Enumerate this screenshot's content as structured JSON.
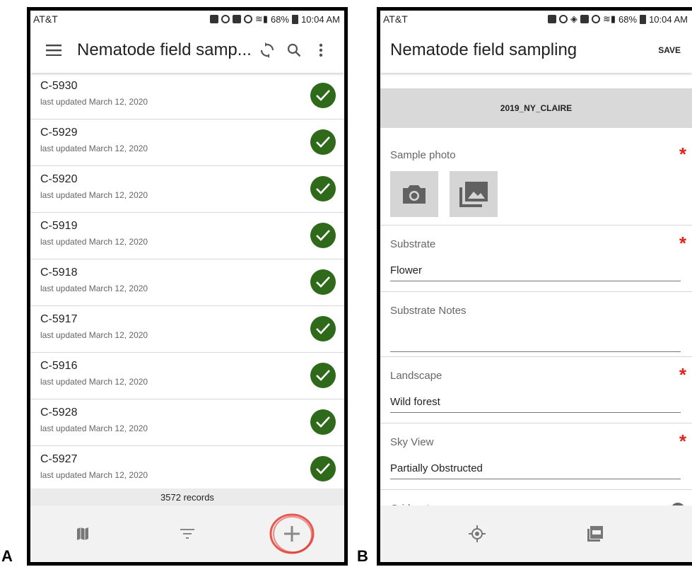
{
  "panels": {
    "a": "A",
    "b": "B"
  },
  "statusbar": {
    "carrier": "AT&T",
    "battery": "68%",
    "time": "10:04 AM"
  },
  "list_screen": {
    "title": "Nematode field samp...",
    "items": [
      {
        "id": "C-5930",
        "updated": "last updated March 12, 2020"
      },
      {
        "id": "C-5929",
        "updated": "last updated March 12, 2020"
      },
      {
        "id": "C-5920",
        "updated": "last updated March 12, 2020"
      },
      {
        "id": "C-5919",
        "updated": "last updated March 12, 2020"
      },
      {
        "id": "C-5918",
        "updated": "last updated March 12, 2020"
      },
      {
        "id": "C-5917",
        "updated": "last updated March 12, 2020"
      },
      {
        "id": "C-5916",
        "updated": "last updated March 12, 2020"
      },
      {
        "id": "C-5928",
        "updated": "last updated March 12, 2020"
      },
      {
        "id": "C-5927",
        "updated": "last updated March 12, 2020"
      }
    ],
    "records_count": "3572 records",
    "nav_icons": [
      "map-icon",
      "filter-icon",
      "add-icon"
    ],
    "check_color": "#2e6a1a",
    "highlight_color": "#e0251b"
  },
  "form_screen": {
    "title": "Nematode field sampling",
    "save_label": "SAVE",
    "project": "2019_NY_CLAIRE",
    "fields": {
      "photo": {
        "label": "Sample photo",
        "required": "*"
      },
      "substrate": {
        "label": "Substrate",
        "value": "Flower",
        "required": "*"
      },
      "substrate_notes": {
        "label": "Substrate Notes",
        "value": ""
      },
      "landscape": {
        "label": "Landscape",
        "value": "Wild forest",
        "required": "*"
      },
      "sky_view": {
        "label": "Sky View",
        "value": "Partially Obstructed",
        "required": "*"
      },
      "gridsect": {
        "label": "Gridsect"
      }
    },
    "accent_color": "#18a1e8",
    "required_color": "#e0251b"
  }
}
